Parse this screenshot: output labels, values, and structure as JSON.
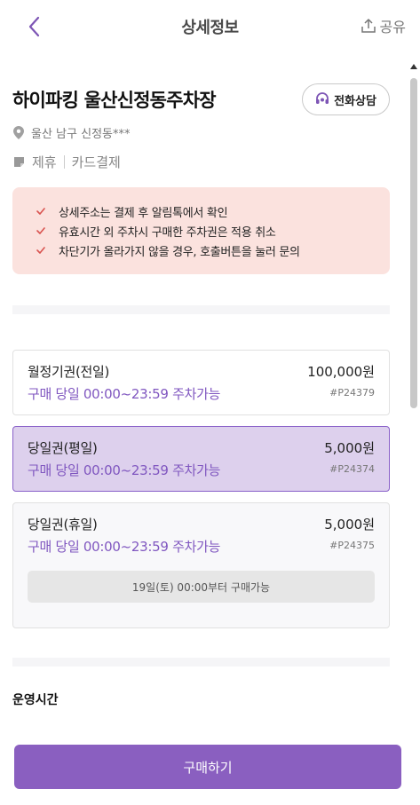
{
  "header": {
    "title": "상세정보",
    "share_label": "공유"
  },
  "lot": {
    "name": "하이파킹 울산신정동주차장",
    "call_label": "전화상담",
    "address": "울산 남구 신정동***",
    "tags": [
      "제휴",
      "카드결제"
    ]
  },
  "notices": [
    "상세주소는 결제 후 알림톡에서 확인",
    "유효시간 외 주차시 구매한 주차권은 적용 취소",
    "차단기가 올라가지 않을 경우, 호출버튼을 눌러 문의"
  ],
  "tickets": [
    {
      "name": "월정기권(전일)",
      "price": "100,000원",
      "time": "구매 당일 00:00~23:59 주차가능",
      "code": "#P24379"
    },
    {
      "name": "당일권(평일)",
      "price": "5,000원",
      "time": "구매 당일 00:00~23:59 주차가능",
      "code": "#P24374"
    },
    {
      "name": "당일권(휴일)",
      "price": "5,000원",
      "time": "구매 당일 00:00~23:59 주차가능",
      "code": "#P24375",
      "availability": "19일(토) 00:00부터 구매가능"
    }
  ],
  "operating_hours": {
    "title": "운영시간"
  },
  "buy_button_label": "구매하기",
  "colors": {
    "accent": "#8a5fc0",
    "selected_bg": "#ddd0ed",
    "notice_bg": "#fbe2de",
    "check": "#d9534f"
  }
}
